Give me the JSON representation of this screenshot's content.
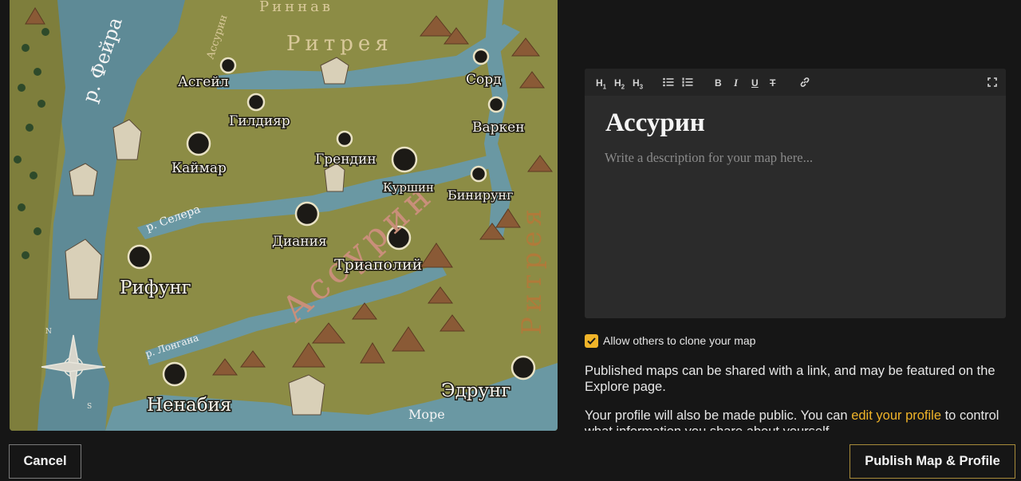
{
  "map": {
    "regions": [
      "Ассурин",
      "Ритрея",
      "Риннав",
      "Ассурин",
      "Ритрея"
    ],
    "rivers": [
      "р. Фейра",
      "р. Селера",
      "р. Лонгана"
    ],
    "sea": "Море",
    "compass": {
      "north": "N",
      "south": "S"
    },
    "cities": [
      "Асгейл",
      "Гилдияр",
      "Каймар",
      "Грендин",
      "Куршин",
      "Сорд",
      "Варкен",
      "Бинирунг",
      "Диания",
      "Триаполий",
      "Рифунг",
      "Ненабия",
      "Эдрунг"
    ]
  },
  "editor": {
    "toolbar": {
      "h1": "H",
      "h2": "H",
      "h3": "H",
      "h1_sub": "1",
      "h2_sub": "2",
      "h3_sub": "3",
      "bold": "B",
      "italic": "I",
      "underline": "U",
      "strike": "T"
    },
    "title": "Ассурин",
    "description_placeholder": "Write a description for your map here..."
  },
  "options": {
    "clone_label": "Allow others to clone your map",
    "clone_checked": true,
    "published_text": "Published maps can be shared with a link, and may be featured on the Explore page.",
    "profile_text_before": "Your profile will also be made public. You can ",
    "profile_link": "edit your profile",
    "profile_text_after": " to control what information you share about yourself."
  },
  "footer": {
    "cancel_label": "Cancel",
    "publish_label": "Publish Map & Profile"
  },
  "colors": {
    "accent": "#f0b429",
    "background": "#161616",
    "editor_bg": "#2b2b2b"
  }
}
